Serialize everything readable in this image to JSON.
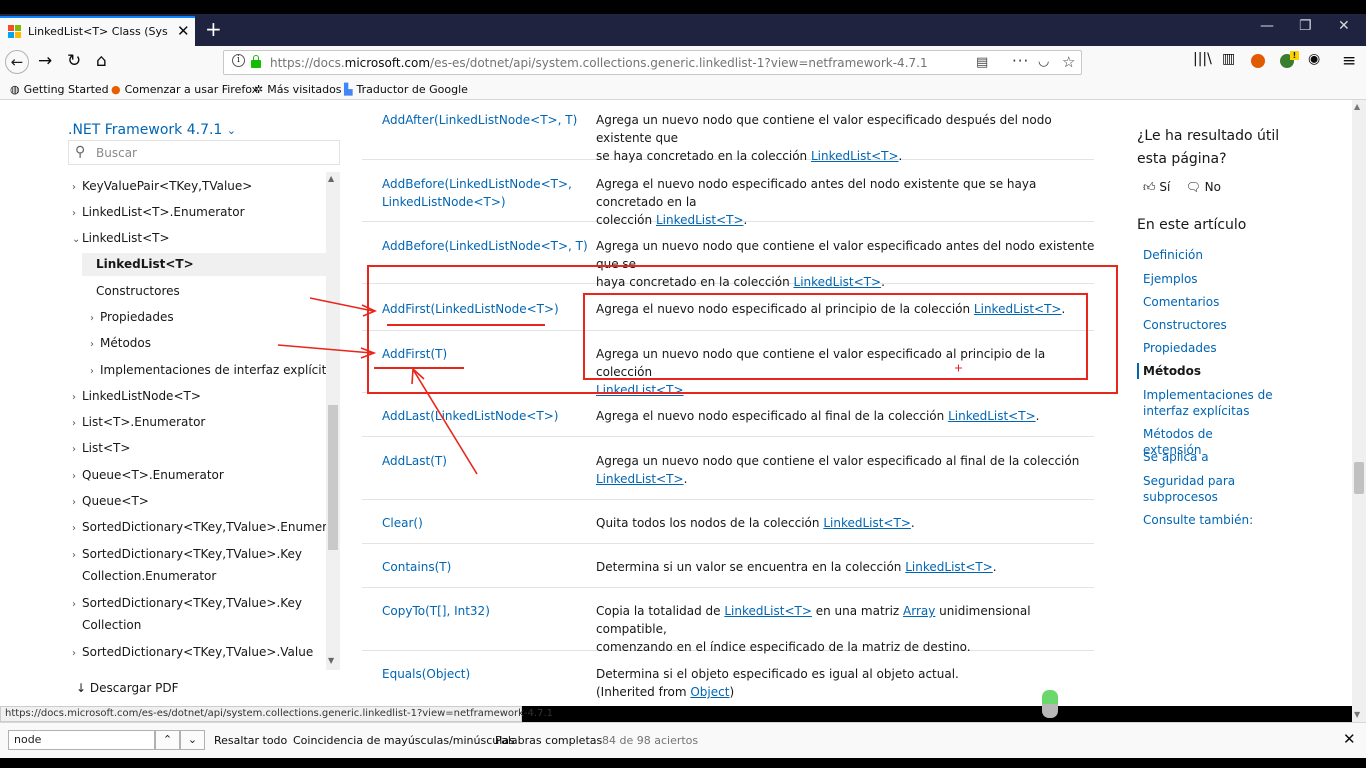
{
  "browser": {
    "tab_title": "LinkedList<T> Class (System.Co",
    "url_prefix": "https://docs.",
    "url_domain": "microsoft.com",
    "url_rest": "/es-es/dotnet/api/system.collections.generic.linkedlist-1?view=netframework-4.7.1",
    "bookmarks": [
      "Getting Started",
      "Comenzar a usar Firefox",
      "Más visitados",
      "Traductor de Google"
    ]
  },
  "nav": {
    "framework": ".NET Framework 4.7.1",
    "search_placeholder": "Buscar",
    "tree": [
      {
        "label": "KeyValuePair<TKey,TValue>",
        "chev": "›"
      },
      {
        "label": "LinkedList<T>.Enumerator",
        "chev": "›"
      },
      {
        "label": "LinkedList<T>",
        "chev": "⌄"
      },
      {
        "label": "LinkedList<T>",
        "chev": ""
      },
      {
        "label": "Constructores",
        "chev": ""
      },
      {
        "label": "Propiedades",
        "chev": "›"
      },
      {
        "label": "Métodos",
        "chev": "›"
      },
      {
        "label": "Implementaciones de interfaz explícitas",
        "chev": "›"
      },
      {
        "label": "LinkedListNode<T>",
        "chev": "›"
      },
      {
        "label": "List<T>.Enumerator",
        "chev": "›"
      },
      {
        "label": "List<T>",
        "chev": "›"
      },
      {
        "label": "Queue<T>.Enumerator",
        "chev": "›"
      },
      {
        "label": "Queue<T>",
        "chev": "›"
      },
      {
        "label": "SortedDictionary<TKey,TValue>.Enumerator",
        "chev": "›"
      },
      {
        "label": "SortedDictionary<TKey,TValue>.Key",
        "chev": "›"
      },
      {
        "label": "Collection.Enumerator",
        "chev": ""
      },
      {
        "label": "SortedDictionary<TKey,TValue>.Key",
        "chev": "›"
      },
      {
        "label": "Collection",
        "chev": ""
      },
      {
        "label": "SortedDictionary<TKey,TValue>.Value",
        "chev": "›"
      }
    ],
    "download_pdf": "Descargar PDF"
  },
  "methods": [
    {
      "name": [
        "AddAfter(LinkedListNode<T>, T)"
      ],
      "desc1": "Agrega un nuevo nodo que contiene el valor especificado después del nodo existente que",
      "desc2": "se haya concretado en la colección ",
      "link": "LinkedList<T>",
      "tail": "."
    },
    {
      "name": [
        "AddBefore(LinkedListNode<T>,",
        "LinkedListNode<T>)"
      ],
      "desc1": "Agrega el nuevo nodo especificado antes del nodo existente que se haya concretado en la",
      "desc2": "colección ",
      "link": "LinkedList<T>",
      "tail": "."
    },
    {
      "name": [
        "AddBefore(LinkedListNode<T>, T)"
      ],
      "desc1": "Agrega un nuevo nodo que contiene el valor especificado antes del nodo existente que se",
      "desc2": "haya concretado en la colección ",
      "link": "LinkedList<T>",
      "tail": "."
    },
    {
      "name": [
        "AddFirst(LinkedListNode<T>)"
      ],
      "desc1": "Agrega el nuevo nodo especificado al principio de la colección ",
      "desc2": "",
      "link": "LinkedList<T>",
      "tail": "."
    },
    {
      "name": [
        "AddFirst(T)"
      ],
      "desc1": "Agrega un nuevo nodo que contiene el valor especificado al principio de la colección",
      "desc2": "",
      "link": "LinkedList<T>",
      "tail": "."
    },
    {
      "name": [
        "AddLast(LinkedListNode<T>)"
      ],
      "desc1": "Agrega el nuevo nodo especificado al final de la colección ",
      "desc2": "",
      "link": "LinkedList<T>",
      "tail": "."
    },
    {
      "name": [
        "AddLast(T)"
      ],
      "desc1": "Agrega un nuevo nodo que contiene el valor especificado al final de la colección",
      "desc2": "",
      "link": "LinkedList<T>",
      "tail": "."
    },
    {
      "name": [
        "Clear()"
      ],
      "desc1": "Quita todos los nodos de la colección ",
      "desc2": "",
      "link": "LinkedList<T>",
      "tail": "."
    },
    {
      "name": [
        "Contains(T)"
      ],
      "desc1": "Determina si un valor se encuentra en la colección ",
      "desc2": "",
      "link": "LinkedList<T>",
      "tail": "."
    },
    {
      "name": [
        "CopyTo(T[], Int32)"
      ],
      "desc1": "Copia la totalidad de ",
      "desc2": "comenzando en el índice especificado de la matriz de destino.",
      "link": "LinkedList<T>",
      "mid": " en una matriz ",
      "link2": "Array",
      "tail": " unidimensional compatible,"
    },
    {
      "name": [
        "Equals(Object)"
      ],
      "desc1": "Determina si el objeto especificado es igual al objeto actual.",
      "desc2": "(Inherited from ",
      "link": "Object",
      "tail": ")"
    }
  ],
  "feedback": {
    "question": "¿Le ha resultado útil esta página?",
    "yes": "Sí",
    "no": "No"
  },
  "toc": {
    "title": "En este artículo",
    "items": [
      "Definición",
      "Ejemplos",
      "Comentarios",
      "Constructores",
      "Propiedades",
      "Métodos",
      "Implementaciones de interfaz explícitas",
      "Métodos de extensión",
      "Se aplica a",
      "Seguridad para subprocesos",
      "Consulte también:"
    ],
    "active": "Métodos"
  },
  "status_url": "https://docs.microsoft.com/es-es/dotnet/api/system.collections.generic.linkedlist-1?view=netframework-4.7.1",
  "findbar": {
    "query": "node",
    "highlight_all": "Resaltar todo",
    "match_case": "Coincidencia de mayúsculas/minúsculas",
    "whole_words": "Palabras completas",
    "count": "84 de 98 aciertos"
  },
  "colors": {
    "accent": "#0065b3",
    "annotation": "#e8261c",
    "tabstrip": "#202340"
  }
}
